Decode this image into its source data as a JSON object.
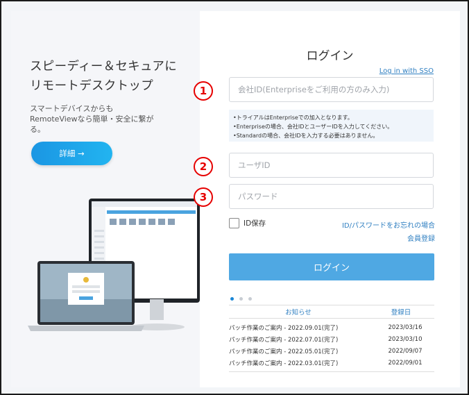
{
  "left_panel": {
    "headline_line1": "スピーディー＆セキュアに",
    "headline_line2": "リモートデスクトップ",
    "subtext": "スマートデバイスからもRemoteViewなら簡単・安全に繋がる。",
    "detail_button_label": "詳細 →"
  },
  "login": {
    "title": "ログイン",
    "sso_link": "Log in with SSO",
    "company_id_placeholder": "会社ID(Enterpriseをご利用の方のみ入力)",
    "notes": [
      "•トライアルはEnterpriseでの加入となります。",
      "•Enterpriseの場合、会社IDとユーザーIDを入力してください。",
      "•Standardの場合、会社IDを入力する必要はありません。"
    ],
    "user_id_placeholder": "ユーザID",
    "password_placeholder": "パスワード",
    "save_id_label": "ID保存",
    "forgot_link": "ID/パスワードをお忘れの場合",
    "register_link": "会員登録",
    "login_button": "ログイン",
    "badges": [
      "1",
      "2",
      "3"
    ],
    "badge_color": "#e60000",
    "accent_color": "#4fa8e3"
  },
  "news": {
    "col_title": "お知らせ",
    "col_date": "登録日",
    "rows": [
      {
        "title": "パッチ作業のご案内 - 2022.09.01(完了)",
        "date": "2023/03/16"
      },
      {
        "title": "パッチ作業のご案内 - 2022.07.01(完了)",
        "date": "2023/03/10"
      },
      {
        "title": "パッチ作業のご案内 - 2022.05.01(完了)",
        "date": "2022/09/07"
      },
      {
        "title": "パッチ作業のご案内 - 2022.03.01(完了)",
        "date": "2022/09/01"
      }
    ]
  }
}
